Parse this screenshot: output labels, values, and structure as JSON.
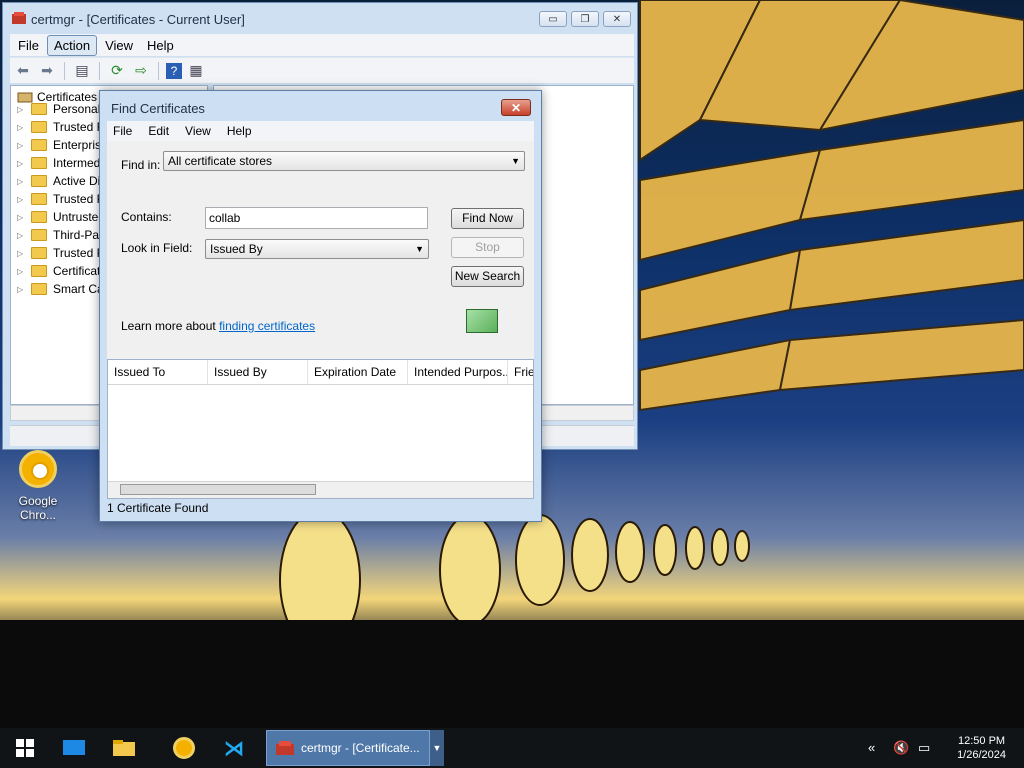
{
  "main_window": {
    "title": "certmgr - [Certificates - Current User]",
    "controls": {
      "minimize": "▭",
      "restore": "❐",
      "close": "✕"
    },
    "menu": [
      "File",
      "Action",
      "View",
      "Help"
    ],
    "active_menu": "Action",
    "tree": {
      "root": "Certificates - Current User",
      "items": [
        "Personal",
        "Trusted Root Certification Authorities",
        "Enterprise Trust",
        "Intermediate Certification Authorities",
        "Active Directory User Object",
        "Trusted Publishers",
        "Untrusted Certificates",
        "Third-Party Root Certification Authorities",
        "Trusted People",
        "Certificate Enrollment Requests",
        "Smart Card Trusted Roots"
      ]
    }
  },
  "find_dialog": {
    "title": "Find Certificates",
    "close_label": "✕",
    "menu": [
      "File",
      "Edit",
      "View",
      "Help"
    ],
    "find_in_label": "Find in:",
    "find_in_value": "All certificate stores",
    "contains_label": "Contains:",
    "contains_value": "collab",
    "look_in_label": "Look in Field:",
    "look_in_value": "Issued By",
    "find_now": "Find Now",
    "stop": "Stop",
    "new_search": "New Search",
    "learn_more_text": "Learn more about ",
    "learn_more_link": "finding certificates",
    "columns": [
      "Issued To",
      "Issued By",
      "Expiration Date",
      "Intended Purpos...",
      "Frier"
    ],
    "status": "1 Certificate Found"
  },
  "desktop": {
    "icon_label": "Google Chro..."
  },
  "taskbar": {
    "active_task_label": "certmgr - [Certificate...",
    "time": "12:50 PM",
    "date": "1/26/2024"
  }
}
